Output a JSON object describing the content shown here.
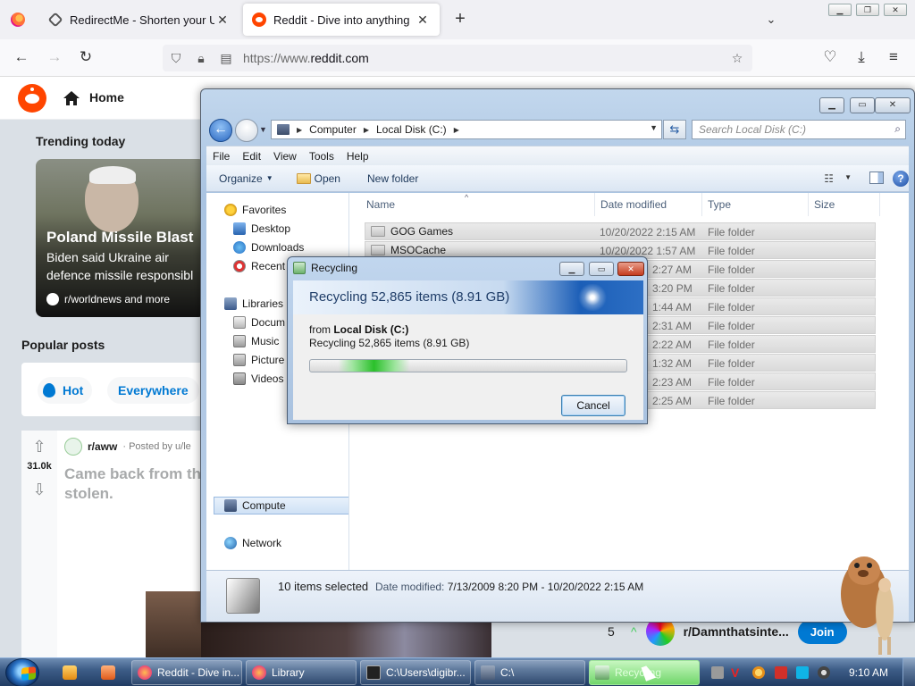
{
  "browser": {
    "tabs": [
      {
        "label": "RedirectMe - Shorten your URL",
        "favicon": "redirect-icon"
      },
      {
        "label": "Reddit - Dive into anything",
        "favicon": "reddit-icon"
      }
    ],
    "url_host": "https://www.",
    "url_domain": "reddit.com"
  },
  "reddit": {
    "home_label": "Home",
    "trending_title": "Trending today",
    "trend": {
      "headline": "Poland Missile Blast",
      "body_line1": "Biden said Ukraine air",
      "body_line2": "defence missile responsibl",
      "subreddit": "r/worldnews and more"
    },
    "popular_title": "Popular posts",
    "sort": {
      "hot": "Hot",
      "everywhere": "Everywhere"
    },
    "post": {
      "subreddit": "r/aww",
      "posted_by": "· Posted by u/le",
      "votes": "31.0k",
      "title_line1": "Came back from th",
      "title_line2": "stolen."
    },
    "sidebar_sub": {
      "rank": "5",
      "name": "r/Damnthatsinte...",
      "join": "Join"
    }
  },
  "explorer": {
    "breadcrumb": [
      "Computer",
      "Local Disk (C:)"
    ],
    "search_placeholder": "Search Local Disk (C:)",
    "menu": [
      "File",
      "Edit",
      "View",
      "Tools",
      "Help"
    ],
    "commands": {
      "organize": "Organize",
      "open": "Open",
      "new_folder": "New folder"
    },
    "nav": {
      "favorites": "Favorites",
      "desktop": "Desktop",
      "downloads": "Downloads",
      "recent": "Recent",
      "libraries": "Libraries",
      "documents": "Docum",
      "music": "Music",
      "pictures": "Picture",
      "videos": "Videos",
      "computer": "Compute",
      "network": "Network"
    },
    "columns": {
      "name": "Name",
      "date": "Date modified",
      "type": "Type",
      "size": "Size"
    },
    "files": [
      {
        "name": "GOG Games",
        "date": "10/20/2022 2:15 AM",
        "type": "File folder"
      },
      {
        "name": "MSOCache",
        "date": "10/20/2022 1:57 AM",
        "type": "File folder"
      },
      {
        "name": "",
        "date": "2:27 AM",
        "type": "File folder"
      },
      {
        "name": "",
        "date": "3:20 PM",
        "type": "File folder"
      },
      {
        "name": "",
        "date": "1:44 AM",
        "type": "File folder"
      },
      {
        "name": "",
        "date": "2:31 AM",
        "type": "File folder"
      },
      {
        "name": "",
        "date": "2:22 AM",
        "type": "File folder"
      },
      {
        "name": "",
        "date": "1:32 AM",
        "type": "File folder"
      },
      {
        "name": "",
        "date": "2:23 AM",
        "type": "File folder"
      },
      {
        "name": "",
        "date": "2:25 AM",
        "type": "File folder"
      }
    ],
    "details": {
      "count": "10 items selected",
      "modified_label": "Date modified:",
      "modified_value": "7/13/2009 8:20 PM - 10/20/2022 2:15 AM"
    }
  },
  "dialog": {
    "title": "Recycling",
    "heading": "Recycling 52,865 items (8.91 GB)",
    "from_label": "from",
    "from_value": "Local Disk (C:)",
    "status": "Recycling 52,865 items (8.91 GB)",
    "progress_fraction": 0.45,
    "cancel": "Cancel"
  },
  "taskbar": {
    "buttons": [
      {
        "label": "Reddit - Dive in...",
        "icon": "firefox-icon"
      },
      {
        "label": "Library",
        "icon": "firefox-icon"
      },
      {
        "label": "C:\\Users\\digibr...",
        "icon": "cmd-icon"
      },
      {
        "label": "C:\\",
        "icon": "explorer-icon"
      },
      {
        "label": "Recycling",
        "icon": "recycle-icon"
      }
    ],
    "clock": "9:10 AM"
  }
}
